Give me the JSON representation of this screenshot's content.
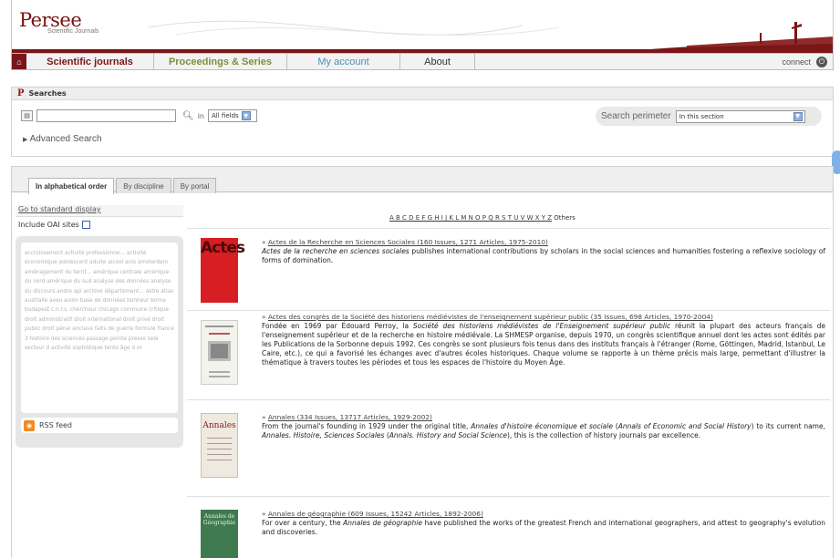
{
  "header": {
    "logo_text": "Persee",
    "logo_subtitle": "Scientific Journals"
  },
  "nav": {
    "home_icon": "home-icon",
    "tabs": [
      {
        "label": "Scientific journals"
      },
      {
        "label": "Proceedings & Series"
      },
      {
        "label": "My account"
      },
      {
        "label": "About"
      }
    ],
    "connect_label": "connect",
    "connect_icon": "power-icon"
  },
  "searches": {
    "title": "Searches",
    "query_value": "",
    "in_label": "in",
    "field_select": "All fields",
    "advanced_label": "Advanced Search",
    "perimeter_label": "Search perimeter",
    "perimeter_select": "In this section"
  },
  "tabs": [
    {
      "label": "In alphabetical order"
    },
    {
      "label": "By discipline"
    },
    {
      "label": "By portal"
    }
  ],
  "left": {
    "standard_display": "Go to standard display",
    "include_oai": "Include OAI sites",
    "tag_cloud": "accroissement activité professionne... activité économique adolescent adulte alcool anis amsterdam aménagement du territ... amérique centrale amérique du nord amérique du sud analyse des données analyse du discours andre api archive département... astre atlas australie aveu avion base de données bonheur borne budapest c.n.r.s. chercheur chicago commune critique droit administratif droit international droit privé droit public droit pénal enclave faits de guerre formule france 3 histoire des sciences passage pointe presse sele secteur d activité sophistique tente âge d or",
    "rss_label": "RSS feed"
  },
  "alphabet": {
    "letters": "A B C D E F G H I J K L M N O P Q R S T U V W X Y Z",
    "others": "Others"
  },
  "entries": [
    {
      "title": "Actes de la Recherche en Sciences Sociales (160 Issues, 1271 Articles, 1975-2010)",
      "desc_italic": "Actes de la recherche en sciences sociales",
      "desc_rest": " publishes international contributions by scholars in the social sciences and humanities fostering a reflexive sociology of forms of domination.",
      "thumb_text": "Actes"
    },
    {
      "title": "Actes des congrès de la Société des historiens médiévistes de l'enseignement supérieur public (35 Issues, 698 Articles, 1970-2004)",
      "desc_a": "Fondée en 1969 par Édouard Perroy, la ",
      "desc_italic": "Société des historiens médiévistes de l'Enseignement supérieur public",
      "desc_b": " réunit la plupart des acteurs français de l'enseignement supérieur et de la recherche en histoire médiévale. La SHMESP organise, depuis 1970, un congrès scientifique annuel dont les actes sont édités par les Publications de la Sorbonne depuis 1992. Ces congrès se sont plusieurs fois tenus dans des instituts français à l'étranger (Rome, Göttingen, Madrid, Istanbul, Le Caire, etc.), ce qui a favorisé les échanges avec d'autres écoles historiques. Chaque volume se rapporte à un thème précis mais large, permettant d'illustrer la thématique à travers toutes les périodes et tous les espaces de l'histoire du Moyen Âge."
    },
    {
      "title": "Annales (334 Issues, 13717 Articles, 1929-2002)",
      "desc_a": "From the journal's founding in 1929 under the original title, ",
      "desc_i1": "Annales d'histoire économique et sociale",
      "desc_b": " (",
      "desc_i2": "Annals of Economic and Social History",
      "desc_c": ") to its current name, ",
      "desc_i3": "Annales. Histoire, Sciences Sociales",
      "desc_d": " (",
      "desc_i4": "Annals. History and Social Science",
      "desc_e": "), this is the collection of history journals par excellence.",
      "thumb_text": "Annales"
    },
    {
      "title": "Annales de géographie (609 Issues, 15242 Articles, 1892-2006)",
      "desc_a": "For over a century, the ",
      "desc_italic": "Annales de géographie",
      "desc_b": " have published the works of the greatest French and international geographers, and attest to geography's evolution and discoveries.",
      "thumb_text": "Annales de Géographie"
    }
  ],
  "colors": {
    "brand": "#7a1618",
    "olive": "#7f8f3c",
    "blue": "#4a91b2"
  }
}
